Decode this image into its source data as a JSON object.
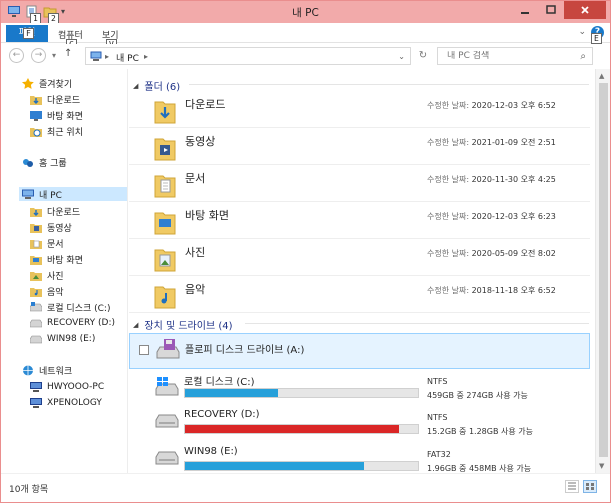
{
  "window": {
    "title": "내 PC"
  },
  "keytips": {
    "qat1": "1",
    "qat2": "2",
    "file": "F",
    "computer": "C",
    "view": "V",
    "help": "E"
  },
  "ribbon": {
    "file_label": "파일",
    "tabs": [
      "컴퓨터",
      "보기"
    ],
    "help": "?"
  },
  "address": {
    "breadcrumb_1": "내 PC"
  },
  "search": {
    "placeholder": "내 PC 검색"
  },
  "nav": {
    "favorites": "즐겨찾기",
    "favorites_items": [
      "다운로드",
      "바탕 화면",
      "최근 위치"
    ],
    "homegroup": "홈 그룹",
    "thispc": "내 PC",
    "thispc_items": [
      "다운로드",
      "동영상",
      "문서",
      "바탕 화면",
      "사진",
      "음악",
      "로컬 디스크 (C:)",
      "RECOVERY (D:)",
      "WIN98 (E:)"
    ],
    "network": "네트워크",
    "network_items": [
      "HWYOOO-PC",
      "XPENOLOGY"
    ]
  },
  "folders_group": {
    "label": "폴더 (6)"
  },
  "folders": [
    {
      "name": "다운로드",
      "date_label": "수정한 날짜:",
      "date": "2020-12-03 오후 6:52"
    },
    {
      "name": "동영상",
      "date_label": "수정한 날짜:",
      "date": "2021-01-09 오전 2:51"
    },
    {
      "name": "문서",
      "date_label": "수정한 날짜:",
      "date": "2020-11-30 오후 4:25"
    },
    {
      "name": "바탕 화면",
      "date_label": "수정한 날짜:",
      "date": "2020-12-03 오후 6:23"
    },
    {
      "name": "사진",
      "date_label": "수정한 날짜:",
      "date": "2020-05-09 오전 8:02"
    },
    {
      "name": "음악",
      "date_label": "수정한 날짜:",
      "date": "2018-11-18 오후 6:52"
    }
  ],
  "drives_group": {
    "label": "장치 및 드라이브 (4)"
  },
  "drives": [
    {
      "name": "플로피 디스크 드라이브 (A:)"
    },
    {
      "name": "로컬 디스크 (C:)",
      "fs": "NTFS",
      "free": "459GB 중 274GB 사용 가능",
      "used_fraction": 0.4,
      "bar_color": "#26a0da"
    },
    {
      "name": "RECOVERY (D:)",
      "fs": "NTFS",
      "free": "15.2GB 중 1.28GB 사용 가능",
      "used_fraction": 0.92,
      "bar_color": "#da2626"
    },
    {
      "name": "WIN98 (E:)",
      "fs": "FAT32",
      "free": "1.96GB 중 458MB 사용 가능",
      "used_fraction": 0.77,
      "bar_color": "#26a0da"
    }
  ],
  "status": {
    "count": "10개 항목"
  },
  "colors": {
    "title_bar": "#f2aaaa",
    "accent": "#1979ca",
    "close": "#c7463f",
    "selection": "#cce8ff"
  }
}
